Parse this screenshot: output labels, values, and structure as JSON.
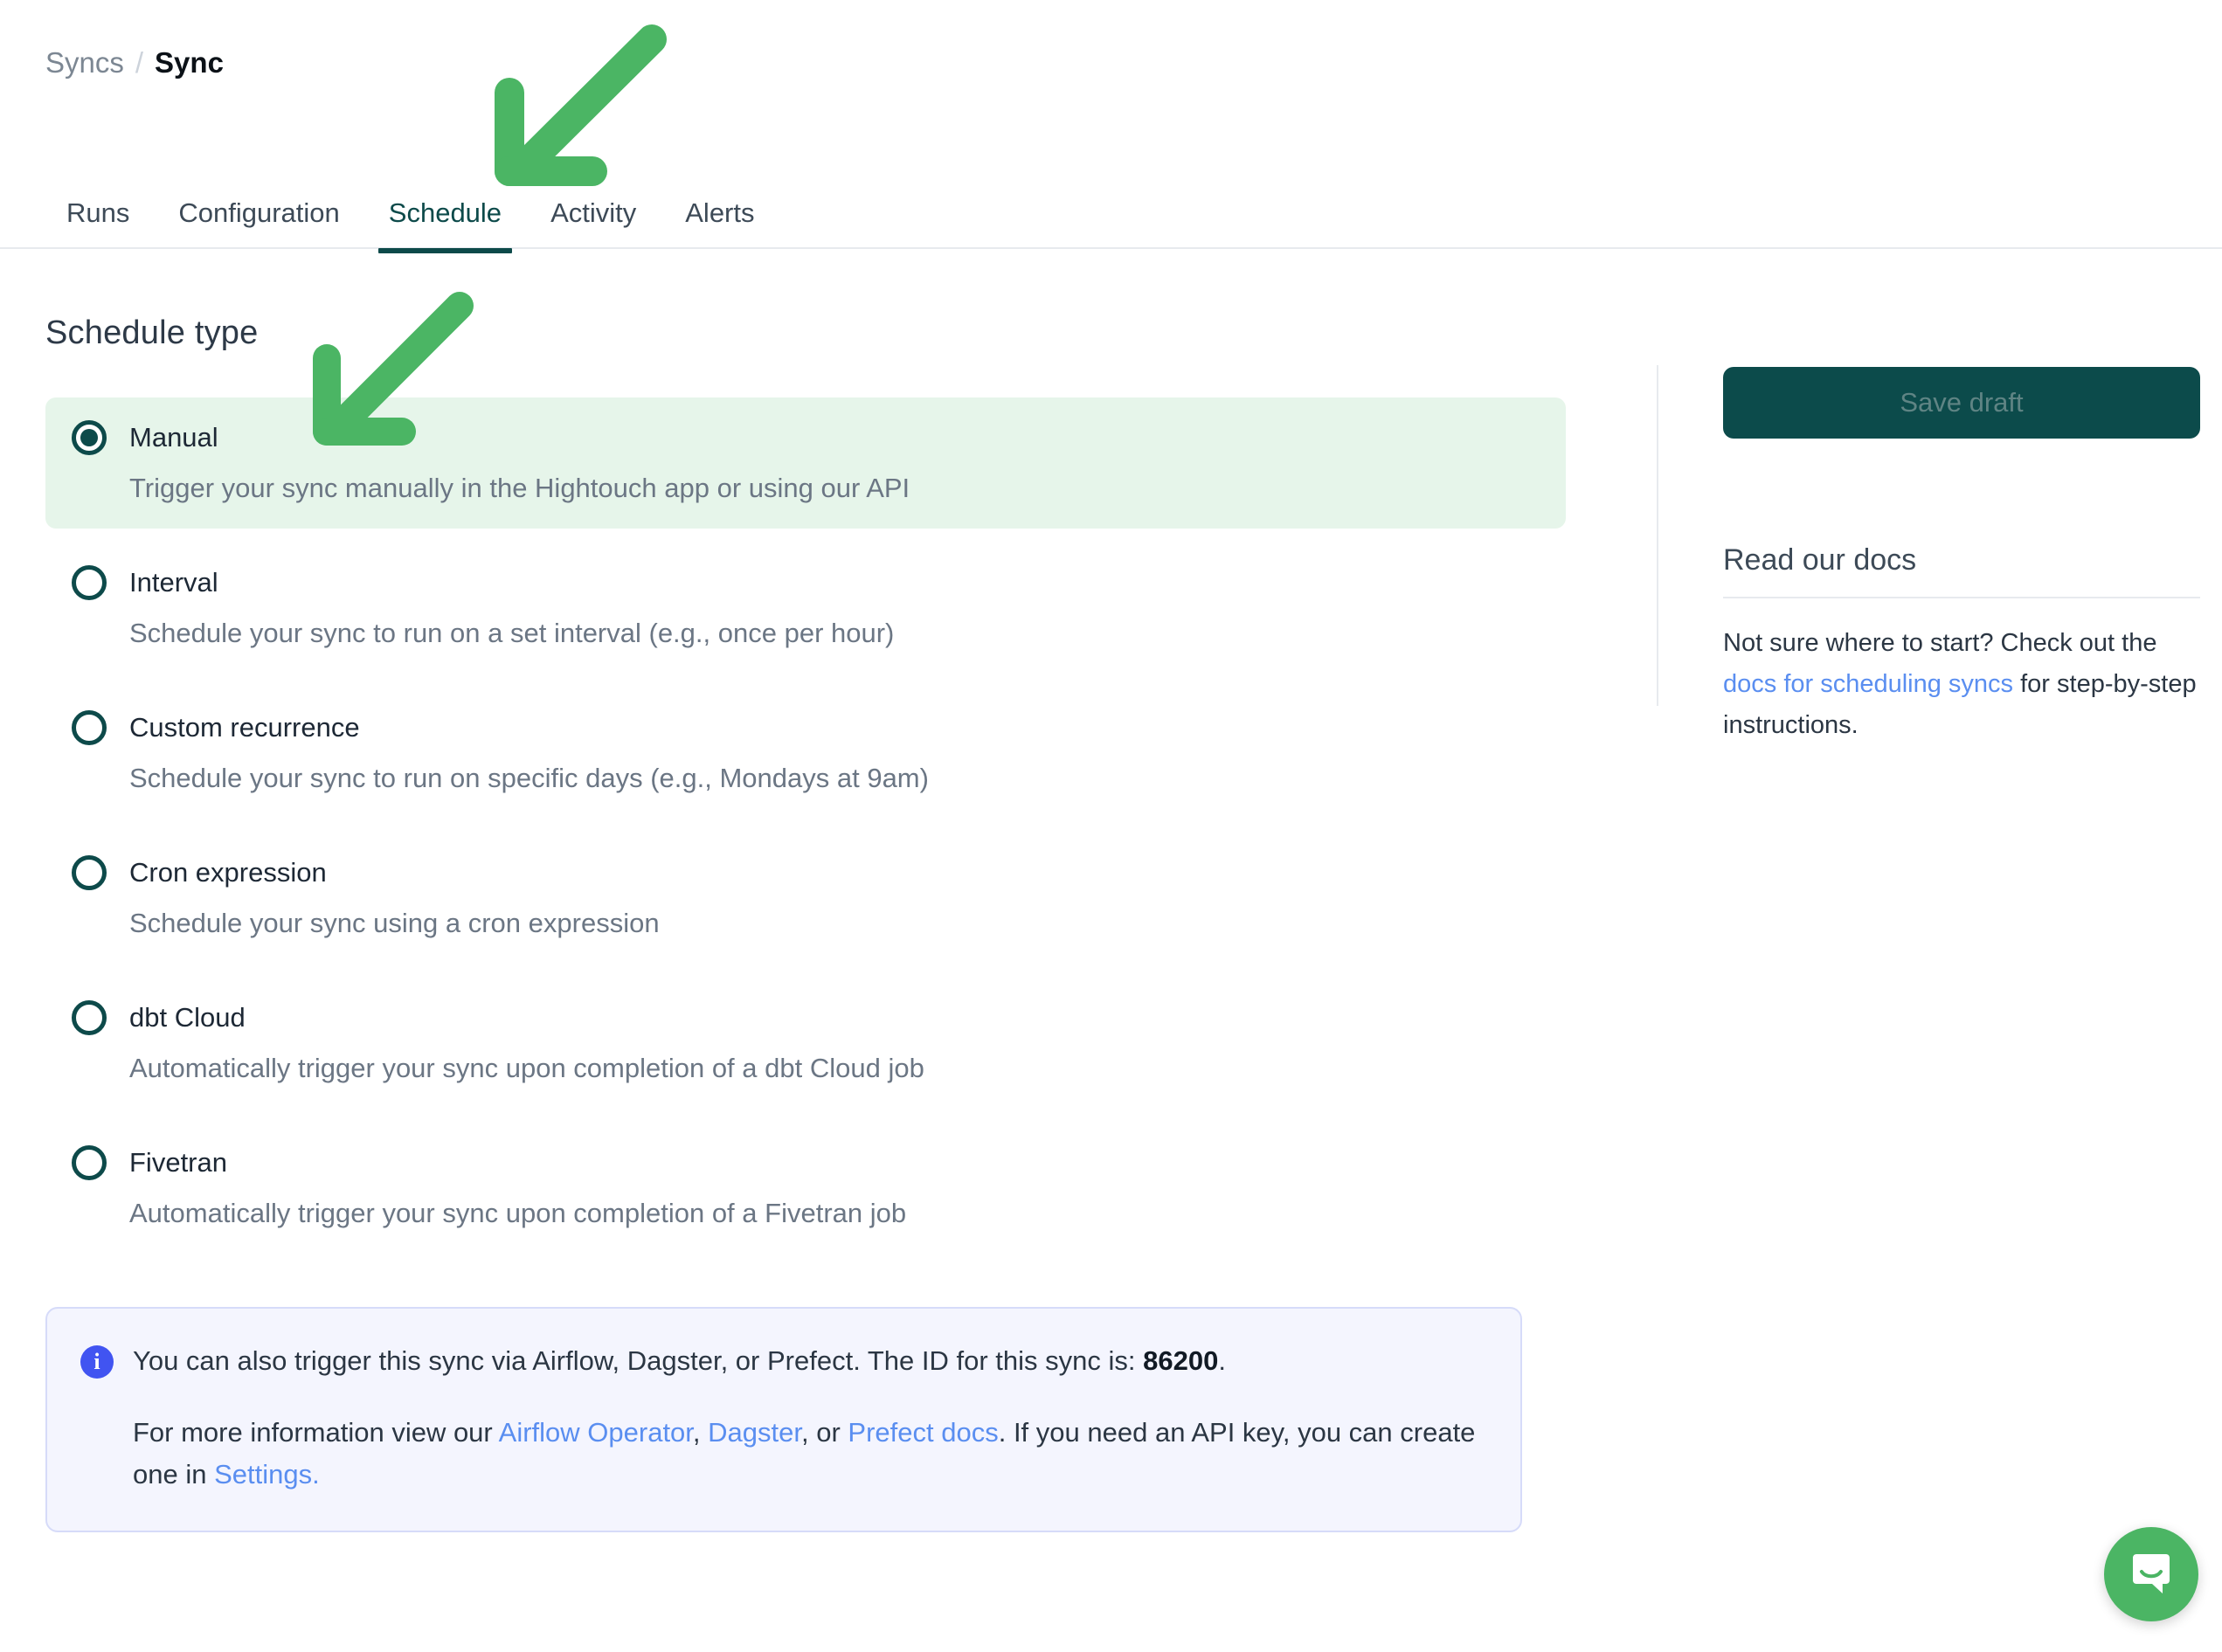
{
  "breadcrumb": {
    "parent": "Syncs",
    "separator": "/",
    "current": "Sync"
  },
  "tabs": [
    {
      "label": "Runs",
      "active": false
    },
    {
      "label": "Configuration",
      "active": false
    },
    {
      "label": "Schedule",
      "active": true
    },
    {
      "label": "Activity",
      "active": false
    },
    {
      "label": "Alerts",
      "active": false
    }
  ],
  "main": {
    "section_title": "Schedule type",
    "options": [
      {
        "label": "Manual",
        "description": "Trigger your sync manually in the Hightouch app or using our API",
        "selected": true
      },
      {
        "label": "Interval",
        "description": "Schedule your sync to run on a set interval (e.g., once per hour)",
        "selected": false
      },
      {
        "label": "Custom recurrence",
        "description": "Schedule your sync to run on specific days (e.g., Mondays at 9am)",
        "selected": false
      },
      {
        "label": "Cron expression",
        "description": "Schedule your sync using a cron expression",
        "selected": false
      },
      {
        "label": "dbt Cloud",
        "description": "Automatically trigger your sync upon completion of a dbt Cloud job",
        "selected": false
      },
      {
        "label": "Fivetran",
        "description": "Automatically trigger your sync upon completion of a Fivetran job",
        "selected": false
      }
    ]
  },
  "callout": {
    "icon": "info-icon",
    "line1_prefix": "You can also trigger this sync via Airflow, Dagster, or Prefect. The ID for this sync is: ",
    "sync_id": "86200",
    "line1_suffix": ".",
    "line2_prefix": "For more information view our ",
    "link_airflow": "Airflow Operator",
    "sep1": ", ",
    "link_dagster": "Dagster",
    "sep2": ", or ",
    "link_prefect": "Prefect docs",
    "line2_mid": ". If you need an API key, you can create one in ",
    "link_settings": "Settings.",
    "line2_suffix": ""
  },
  "rail": {
    "save_label": "Save draft",
    "docs_heading": "Read our docs",
    "docs_text_prefix": "Not sure where to start? Check out the ",
    "docs_link": "docs for scheduling syncs",
    "docs_text_suffix": " for step-by-step instructions."
  },
  "annotations": {
    "arrow_color": "#4bb564",
    "arrow_1_target": "Schedule tab",
    "arrow_2_target": "Manual option"
  },
  "chat": {
    "icon": "chat-bubble-icon",
    "color": "#4bb564"
  },
  "colors": {
    "accent_teal": "#0d4a4a",
    "selected_row_bg": "#e6f5ea",
    "link_blue": "#5a8ef0",
    "callout_bg": "#f4f5fe",
    "callout_border": "#d6dbf9",
    "info_icon_blue": "#4154f1",
    "annotation_green": "#4bb564"
  }
}
